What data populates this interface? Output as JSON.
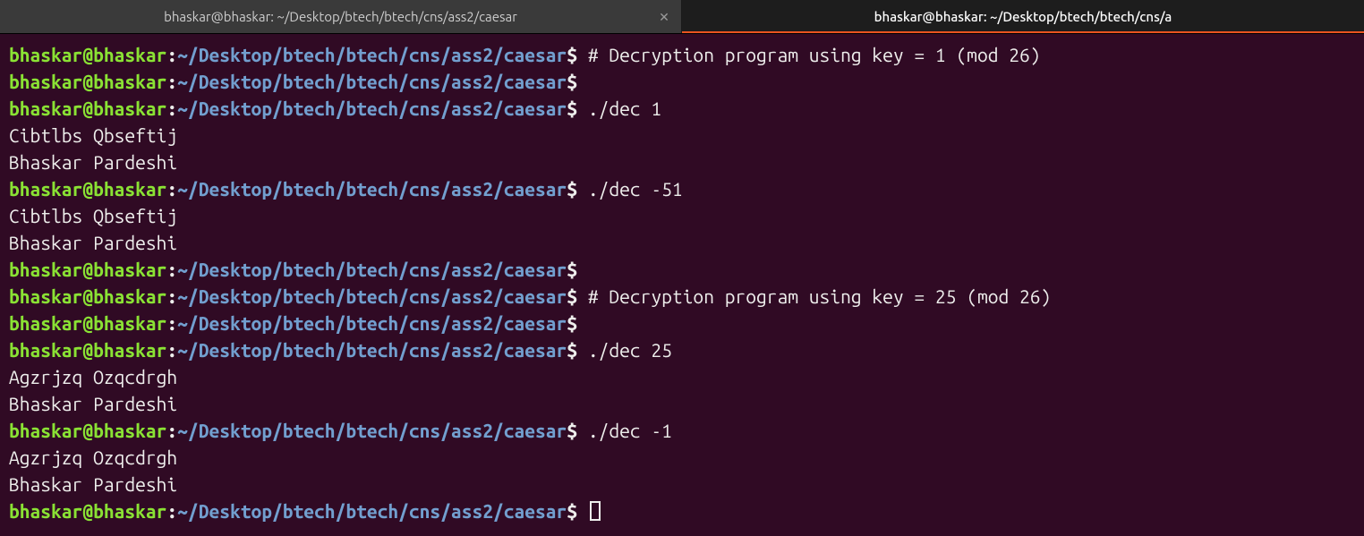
{
  "tabs": [
    {
      "title": "bhaskar@bhaskar: ~/Desktop/btech/btech/cns/ass2/caesar",
      "active": false
    },
    {
      "title": "bhaskar@bhaskar: ~/Desktop/btech/btech/cns/a",
      "active": true
    }
  ],
  "prompt": {
    "user_host": "bhaskar@bhaskar",
    "separator": ":",
    "path": "~/Desktop/btech/btech/cns/ass2/caesar",
    "symbol": "$"
  },
  "session": [
    {
      "type": "cmd",
      "text": "# Decryption program using key = 1 (mod 26)"
    },
    {
      "type": "cmd",
      "text": ""
    },
    {
      "type": "cmd",
      "text": "./dec 1"
    },
    {
      "type": "out",
      "text": "Cibtlbs Qbseftij"
    },
    {
      "type": "out",
      "text": "Bhaskar Pardeshi"
    },
    {
      "type": "cmd",
      "text": "./dec -51"
    },
    {
      "type": "out",
      "text": "Cibtlbs Qbseftij"
    },
    {
      "type": "out",
      "text": "Bhaskar Pardeshi"
    },
    {
      "type": "cmd",
      "text": ""
    },
    {
      "type": "cmd",
      "text": "# Decryption program using key = 25 (mod 26)"
    },
    {
      "type": "cmd",
      "text": ""
    },
    {
      "type": "cmd",
      "text": "./dec 25"
    },
    {
      "type": "out",
      "text": "Agzrjzq Ozqcdrgh"
    },
    {
      "type": "out",
      "text": "Bhaskar Pardeshi"
    },
    {
      "type": "cmd",
      "text": "./dec -1"
    },
    {
      "type": "out",
      "text": "Agzrjzq Ozqcdrgh"
    },
    {
      "type": "out",
      "text": "Bhaskar Pardeshi"
    },
    {
      "type": "cmd",
      "text": "",
      "cursor": true
    }
  ]
}
